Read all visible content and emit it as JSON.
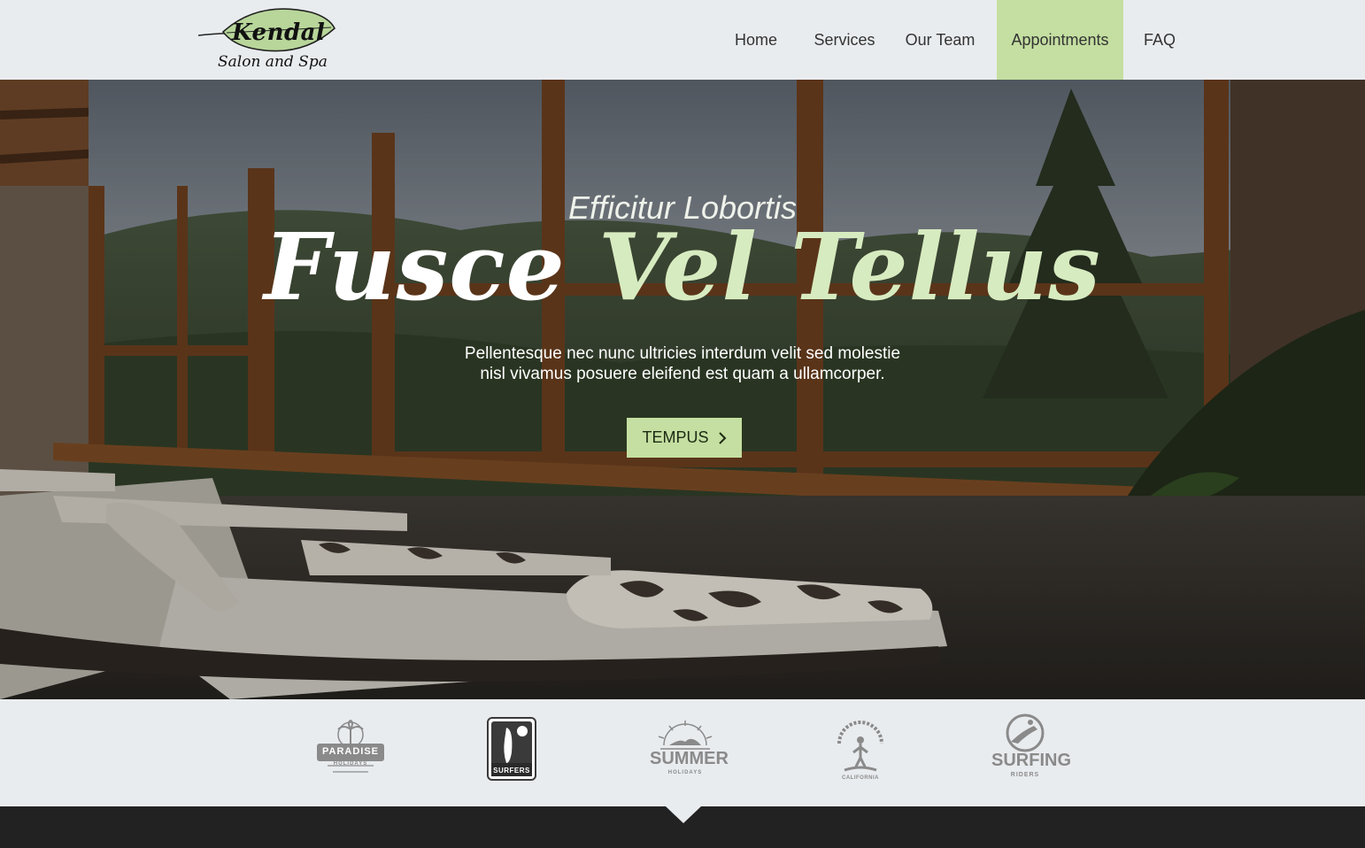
{
  "brand": {
    "name": "Kendal",
    "tagline": "Salon and Spa",
    "accent_color": "#c4dfa1"
  },
  "nav": {
    "items": [
      {
        "label": "Home"
      },
      {
        "label": "Services"
      },
      {
        "label": "Our Team"
      },
      {
        "label": "Appointments",
        "active": true
      },
      {
        "label": "FAQ"
      }
    ]
  },
  "hero": {
    "eyebrow": "Efficitur Lobortis",
    "title_part1": "Fusce",
    "title_part2": "Vel Tellus",
    "text_line1": "Pellentesque nec nunc ultricies interdum velit sed molestie",
    "text_line2": "nisl vivamus posuere eleifend est quam a ullamcorper.",
    "button_label": "TEMPUS",
    "button_icon": "chevron-right-icon"
  },
  "partners": [
    {
      "name": "PARADISE",
      "sub": "HOLIDAYS",
      "icon": "palm-tree-icon"
    },
    {
      "name": "SURFERS",
      "icon": "surfer-board-icon"
    },
    {
      "name": "SUMMER",
      "sub": "HOLIDAYS",
      "icon": "sun-swimmer-icon"
    },
    {
      "name": "BEACH SURFING CLUB",
      "sub": "CALIFORNIA",
      "icon": "surfer-icon"
    },
    {
      "name": "SURFING",
      "sub": "RIDERS",
      "icon": "wave-surfer-icon"
    }
  ]
}
